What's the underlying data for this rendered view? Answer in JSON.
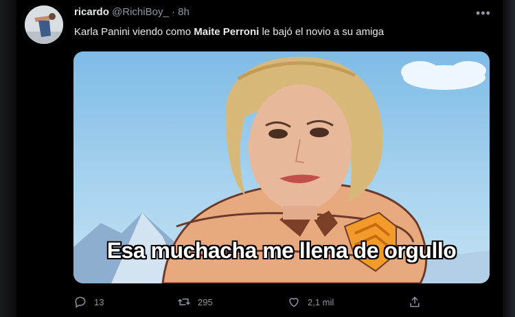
{
  "tweet": {
    "author_name": "ricardo",
    "author_handle": "@RichiBoy_",
    "separator": "·",
    "time": "8h",
    "more_icon": "ellipsis-icon",
    "text_before": "Karla Panini viendo como ",
    "text_bold": "Maite Perroni",
    "text_after": " le bajó el novio a su amiga"
  },
  "media": {
    "caption": "Esa muchacha me llena de orgullo"
  },
  "actions": {
    "reply_count": "13",
    "retweet_count": "295",
    "like_count": "2,1 mil",
    "reply_icon": "reply-icon",
    "retweet_icon": "retweet-icon",
    "like_icon": "heart-icon",
    "share_icon": "share-icon"
  },
  "colors": {
    "background": "#000000",
    "muted_text": "#8b98a5",
    "text": "#e7e9ea"
  }
}
